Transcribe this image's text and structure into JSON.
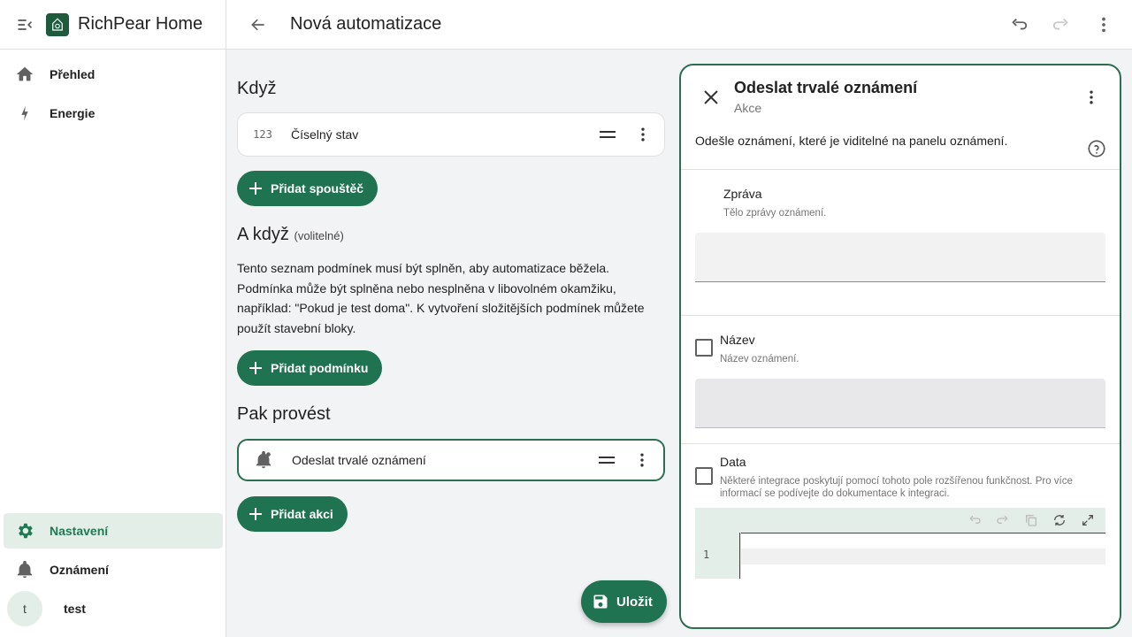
{
  "app": {
    "title": "RichPear Home"
  },
  "sidebar": {
    "top_items": [
      {
        "label": "Přehled",
        "icon": "home-icon"
      },
      {
        "label": "Energie",
        "icon": "lightning-icon"
      }
    ],
    "bottom_items": [
      {
        "label": "Nastavení",
        "icon": "gear-icon",
        "active": true
      },
      {
        "label": "Oznámení",
        "icon": "bell-icon"
      }
    ],
    "user": {
      "initial": "t",
      "name": "test"
    }
  },
  "topbar": {
    "title": "Nová automatizace"
  },
  "main": {
    "when": {
      "heading": "Když",
      "trigger": {
        "icon_text": "123",
        "label": "Číselný stav"
      },
      "add_label": "Přidat spouštěč"
    },
    "and_if": {
      "heading": "A když",
      "optional": "(volitelné)",
      "description": "Tento seznam podmínek musí být splněn, aby automatizace běžela. Podmínka může být splněna nebo nesplněna v libovolném okamžiku, například: \"Pokud je test doma\". K vytvoření složitějších podmínek můžete použít stavební bloky.",
      "add_label": "Přidat podmínku"
    },
    "then_do": {
      "heading": "Pak provést",
      "action": {
        "label": "Odeslat trvalé oznámení"
      },
      "add_label": "Přidat akci"
    },
    "save_label": "Uložit"
  },
  "panel": {
    "title": "Odeslat trvalé oznámení",
    "subtitle": "Akce",
    "description": "Odešle oznámení, které je viditelné na panelu oznámení.",
    "fields": {
      "message": {
        "label": "Zpráva",
        "help": "Tělo zprávy oznámení.",
        "value": ""
      },
      "title": {
        "label": "Název",
        "help": "Název oznámení.",
        "checked": false
      },
      "data": {
        "label": "Data",
        "help": "Některé integrace poskytují pomocí tohoto pole rozšířenou funkčnost. Pro více informací se podívejte do dokumentace k integraci.",
        "checked": false,
        "line_number": "1"
      }
    }
  },
  "colors": {
    "accent": "#1f7350",
    "accent_light": "#e4eee9",
    "border_active": "#2b6e50"
  }
}
